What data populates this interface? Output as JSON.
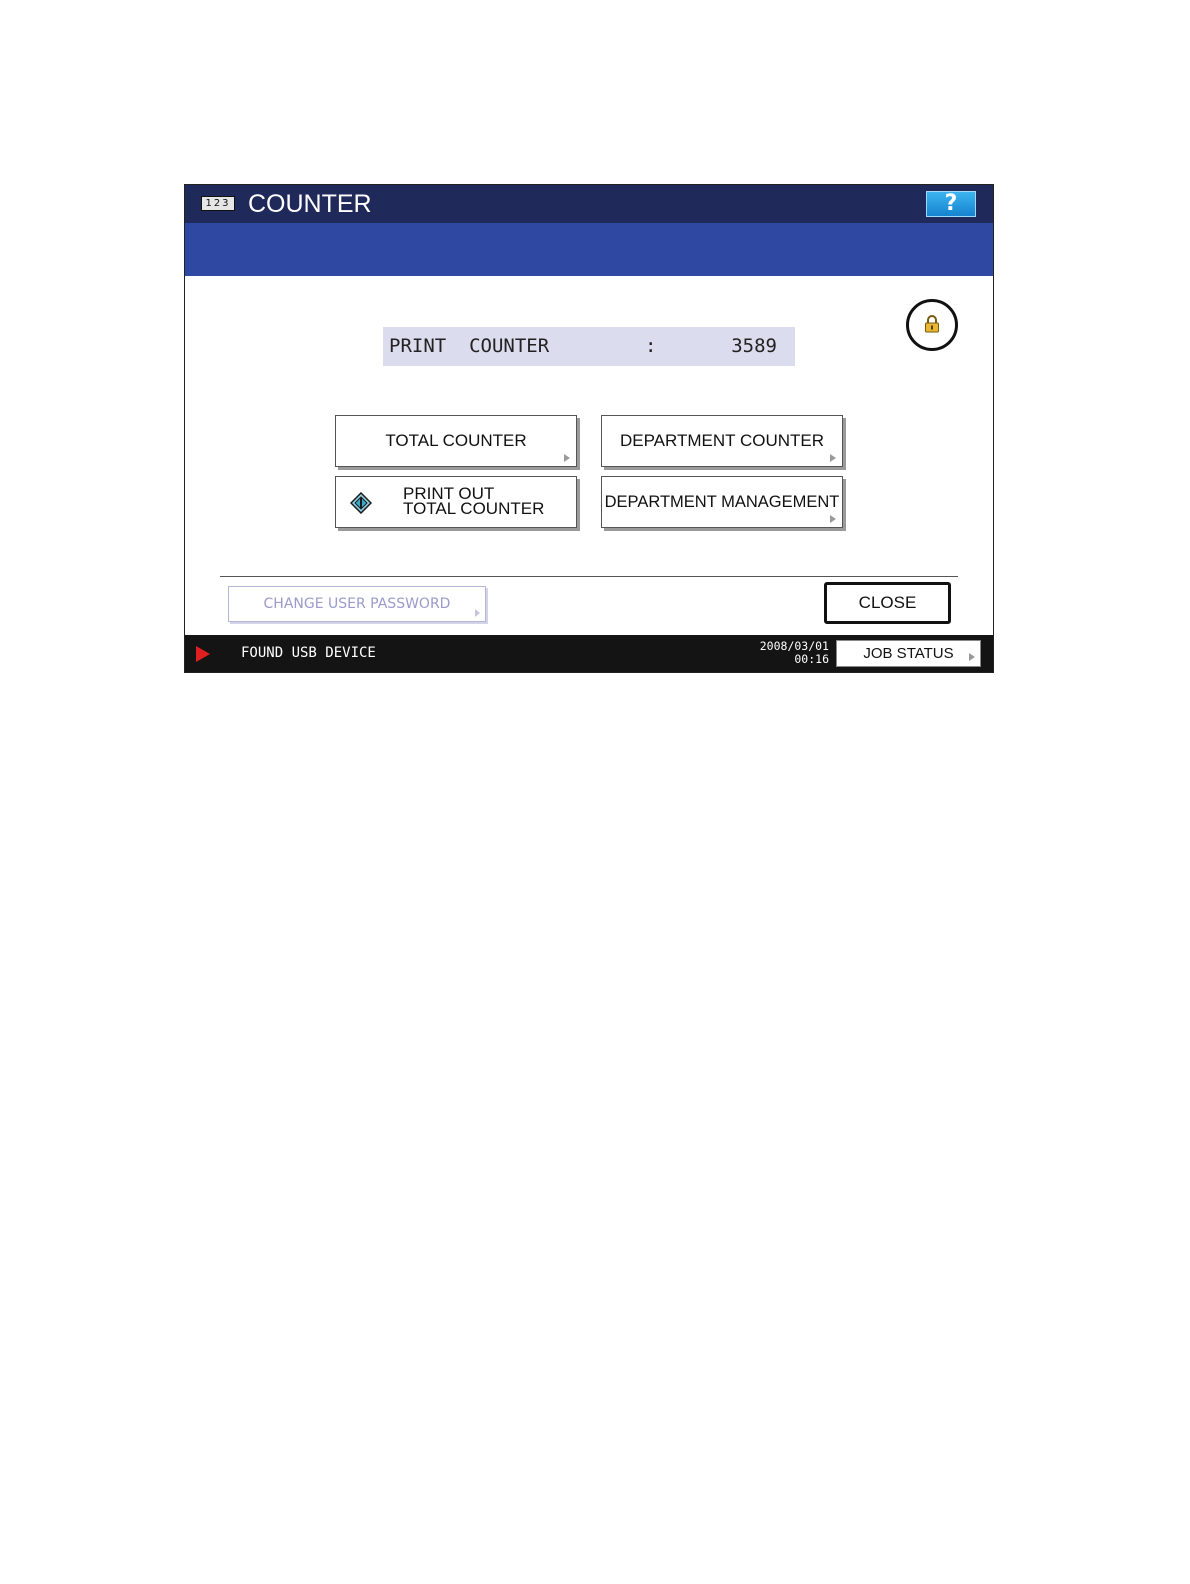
{
  "header": {
    "mode_icon_text": "123",
    "title": "COUNTER",
    "help_label": "?"
  },
  "counter": {
    "label": "PRINT  COUNTER",
    "separator": ":",
    "value": "3589"
  },
  "buttons": {
    "total_counter": "TOTAL COUNTER",
    "department_counter": "DEPARTMENT COUNTER",
    "print_out_line1": "PRINT OUT",
    "print_out_line2": "TOTAL COUNTER",
    "department_management": "DEPARTMENT MANAGEMENT",
    "change_user_password": "CHANGE USER PASSWORD",
    "close": "CLOSE",
    "job_status": "JOB STATUS"
  },
  "status": {
    "message": "FOUND USB DEVICE",
    "date": "2008/03/01",
    "time": "00:16"
  },
  "icons": {
    "lock": "lock-icon",
    "start": "start-diamond-icon",
    "alert": "red-arrow-icon"
  },
  "colors": {
    "title_bar": "#202a5a",
    "sub_bar": "#2f48a2",
    "help_button": "#1f9ae0",
    "counter_bg": "#dcdcef",
    "disabled_text": "#9a9acb",
    "status_bar": "#141414",
    "alert": "#e02020"
  }
}
